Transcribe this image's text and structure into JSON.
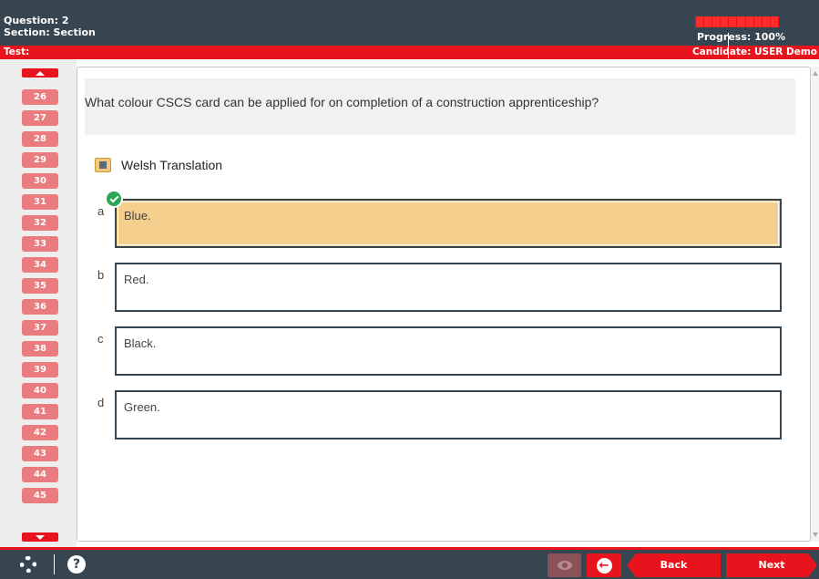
{
  "header": {
    "question_label": "Question: 2",
    "section_label": "Section: Section",
    "progress_label": "Progress: 100%",
    "progress_value": 1.0
  },
  "redbar": {
    "test_label": "Test:",
    "candidate_label": "Candidate: USER Demo"
  },
  "sidebar": {
    "question_numbers": [
      "26",
      "27",
      "28",
      "29",
      "30",
      "31",
      "32",
      "33",
      "34",
      "35",
      "36",
      "37",
      "38",
      "39",
      "40",
      "41",
      "42",
      "43",
      "44",
      "45"
    ]
  },
  "question": {
    "text": "What colour CSCS card can be applied for on completion of a construction apprenticeship?",
    "translation_label": "Welsh Translation",
    "options": [
      {
        "letter": "a",
        "text": "Blue.",
        "selected": true
      },
      {
        "letter": "b",
        "text": "Red.",
        "selected": false
      },
      {
        "letter": "c",
        "text": "Black.",
        "selected": false
      },
      {
        "letter": "d",
        "text": "Green.",
        "selected": false
      }
    ]
  },
  "footer": {
    "back_label": "Back",
    "next_label": "Next",
    "help_symbol": "?",
    "exit_symbol": "←"
  },
  "colors": {
    "header_bg": "#36454f",
    "accent_red": "#e8131c",
    "question_chip": "#ea7b7e",
    "selected_option": "#f5cf8e",
    "correct_check": "#2aa655"
  },
  "icons": [
    "chevron-up-icon",
    "chevron-down-icon",
    "translation-icon",
    "check-icon",
    "gear-icon",
    "help-icon",
    "eye-icon",
    "exit-icon"
  ]
}
